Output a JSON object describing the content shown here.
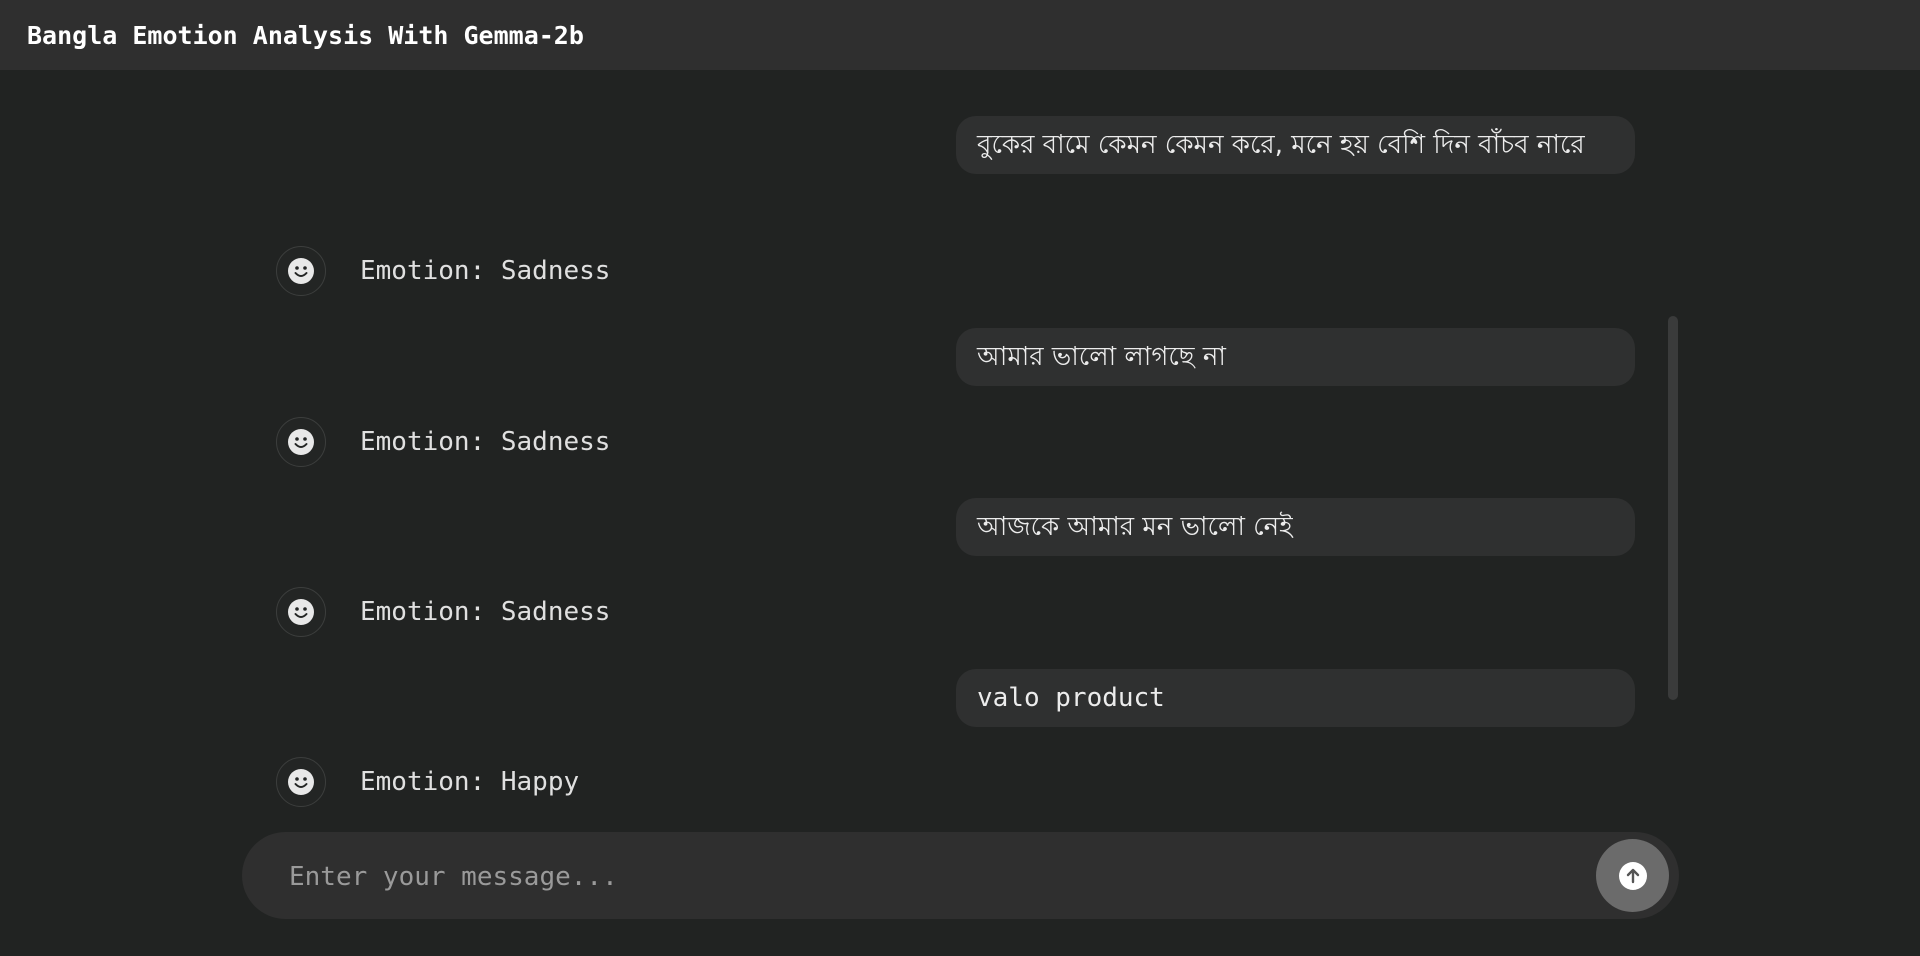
{
  "header": {
    "title": "Bangla Emotion Analysis With Gemma-2b"
  },
  "messages": [
    {
      "role": "user",
      "text": "বুকের বামে কেমন কেমন করে, মনে হয় বেশি দিন বাঁচব নারে"
    },
    {
      "role": "bot",
      "avatar_icon": "smiley-face-icon",
      "text": "Emotion: Sadness"
    },
    {
      "role": "user",
      "text": "আমার ভালো লাগছে না"
    },
    {
      "role": "bot",
      "avatar_icon": "smiley-face-icon",
      "text": "Emotion: Sadness"
    },
    {
      "role": "user",
      "text": "আজকে আমার মন ভালো নেই"
    },
    {
      "role": "bot",
      "avatar_icon": "smiley-face-icon",
      "text": "Emotion: Sadness"
    },
    {
      "role": "user",
      "text": "valo product"
    },
    {
      "role": "bot",
      "avatar_icon": "smiley-face-icon",
      "text": "Emotion: Happy"
    }
  ],
  "input": {
    "placeholder": "Enter your message...",
    "value": ""
  },
  "send_button": {
    "icon": "arrow-up-icon"
  },
  "colors": {
    "background": "#212322",
    "header": "#2f2f2f",
    "bubble": "#2f3030",
    "send_button": "#6b6b6b"
  }
}
